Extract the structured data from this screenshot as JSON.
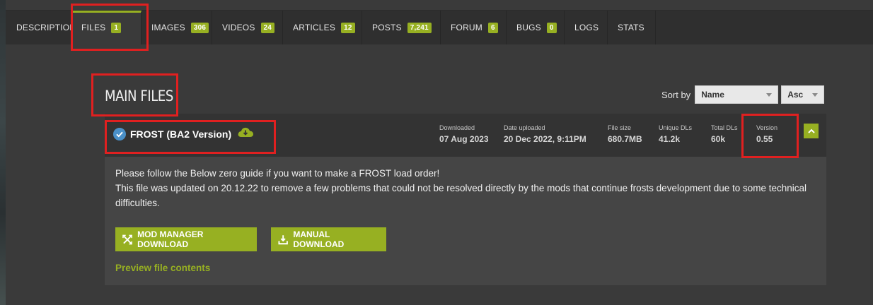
{
  "tabs": [
    {
      "label": "DESCRIPTION",
      "count": null
    },
    {
      "label": "FILES",
      "count": "1"
    },
    {
      "label": "IMAGES",
      "count": "306"
    },
    {
      "label": "VIDEOS",
      "count": "24"
    },
    {
      "label": "ARTICLES",
      "count": "12"
    },
    {
      "label": "POSTS",
      "count": "7,241"
    },
    {
      "label": "FORUM",
      "count": "6"
    },
    {
      "label": "BUGS",
      "count": "0"
    },
    {
      "label": "LOGS",
      "count": null
    },
    {
      "label": "STATS",
      "count": null
    }
  ],
  "section": {
    "title": "MAIN FILES"
  },
  "sort": {
    "label": "Sort by",
    "field": "Name",
    "order": "Asc"
  },
  "file": {
    "name": "FROST (BA2 Version)",
    "stats": {
      "downloaded_label": "Downloaded",
      "downloaded": "07 Aug 2023",
      "uploaded_label": "Date uploaded",
      "uploaded": "20 Dec 2022, 9:11PM",
      "size_label": "File size",
      "size": "680.7MB",
      "unique_label": "Unique DLs",
      "unique": "41.2k",
      "total_label": "Total DLs",
      "total": "60k",
      "version_label": "Version",
      "version": "0.55"
    },
    "description": [
      "Please follow the Below zero guide if you want to make a FROST load order!",
      "This file was updated on 20.12.22 to remove a few problems that could not be resolved directly by the mods that continue frosts development due to some technical difficulties."
    ],
    "mod_manager_label": "MOD MANAGER DOWNLOAD",
    "manual_label": "MANUAL DOWNLOAD",
    "preview_label": "Preview file contents"
  },
  "colors": {
    "accent": "#97b022",
    "highlight": "#e02020",
    "verified": "#4a90c8"
  },
  "icons": [
    "check-circle-icon",
    "cloud-download-icon",
    "chevron-up-icon",
    "mod-manager-icon",
    "download-icon"
  ]
}
